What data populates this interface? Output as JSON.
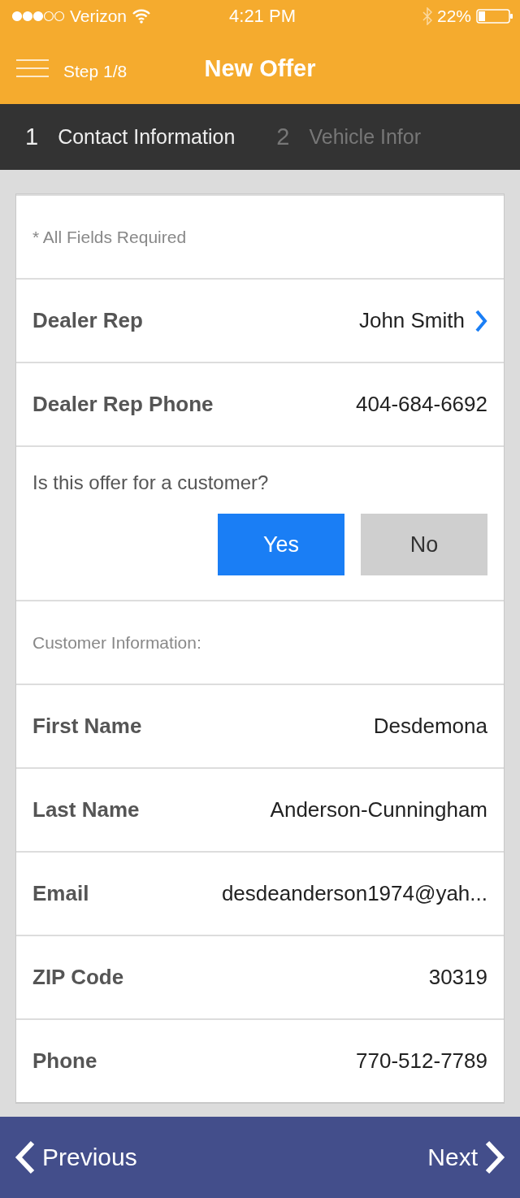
{
  "status_bar": {
    "carrier": "Verizon",
    "time": "4:21 PM",
    "battery": "22%"
  },
  "header": {
    "step": "Step 1/8",
    "title": "New Offer"
  },
  "steps": [
    {
      "number": "1",
      "label": "Contact Information",
      "selected": true
    },
    {
      "number": "2",
      "label": "Vehicle Infor",
      "selected": false
    }
  ],
  "form": [
    {
      "kind": "note",
      "text": "* All Fields Required"
    },
    {
      "kind": "select",
      "label": "Dealer Rep",
      "value": "John Smith"
    },
    {
      "kind": "text",
      "label": "Dealer Rep Phone",
      "value": "404-684-6692"
    },
    {
      "kind": "question",
      "text": "Is this offer for a customer?",
      "options": [
        {
          "label": "Yes",
          "selected": true
        },
        {
          "label": "No",
          "selected": false
        }
      ]
    },
    {
      "kind": "note",
      "text": "Customer Information:"
    },
    {
      "kind": "text",
      "label": "First Name",
      "value": "Desdemona"
    },
    {
      "kind": "text",
      "label": "Last Name",
      "value": "Anderson-Cunningham"
    },
    {
      "kind": "text",
      "label": "Email",
      "value": "desdeanderson1974@yah..."
    },
    {
      "kind": "text",
      "label": "ZIP Code",
      "value": "30319"
    },
    {
      "kind": "text",
      "label": "Phone",
      "value": "770-512-7789"
    }
  ],
  "footer": {
    "previous": "Previous",
    "next": "Next"
  }
}
